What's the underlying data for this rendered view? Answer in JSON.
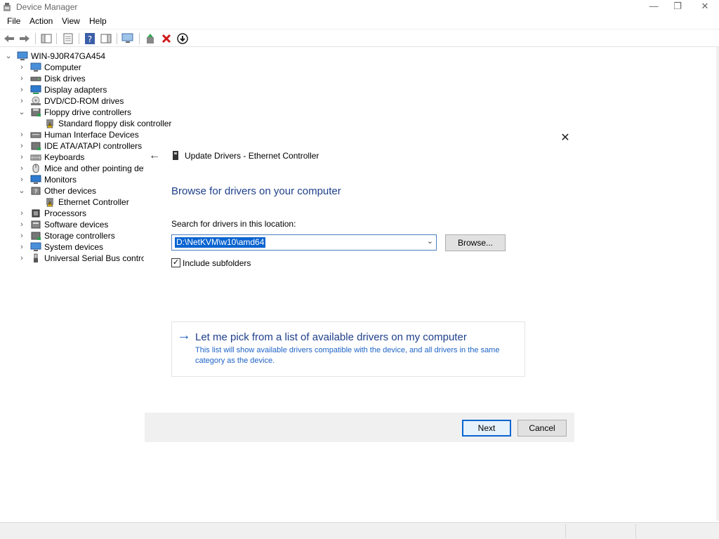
{
  "window": {
    "title": "Device Manager",
    "controls": {
      "minimize": "—",
      "restore": "❐",
      "close": "✕"
    }
  },
  "menu": [
    "File",
    "Action",
    "View",
    "Help"
  ],
  "toolbar_icons": [
    "back-arrow-icon",
    "forward-arrow-icon",
    "show-hide-console-tree-icon",
    "properties-icon",
    "help-icon",
    "action-pane-icon",
    "scan-hardware-icon",
    "update-driver-icon",
    "uninstall-icon",
    "disable-device-icon"
  ],
  "tree": {
    "root": "WIN-9J0R47GA454",
    "items": [
      {
        "label": "Computer",
        "expanded": false
      },
      {
        "label": "Disk drives",
        "expanded": false
      },
      {
        "label": "Display adapters",
        "expanded": false
      },
      {
        "label": "DVD/CD-ROM drives",
        "expanded": false
      },
      {
        "label": "Floppy drive controllers",
        "expanded": true
      },
      {
        "label": "Standard floppy disk controller",
        "child": true,
        "warning": true
      },
      {
        "label": "Human Interface Devices",
        "expanded": false
      },
      {
        "label": "IDE ATA/ATAPI controllers",
        "expanded": false
      },
      {
        "label": "Keyboards",
        "expanded": false
      },
      {
        "label": "Mice and other pointing devic",
        "expanded": false
      },
      {
        "label": "Monitors",
        "expanded": false
      },
      {
        "label": "Other devices",
        "expanded": true
      },
      {
        "label": "Ethernet Controller",
        "child": true,
        "warning": true
      },
      {
        "label": "Processors",
        "expanded": false
      },
      {
        "label": "Software devices",
        "expanded": false
      },
      {
        "label": "Storage controllers",
        "expanded": false
      },
      {
        "label": "System devices",
        "expanded": false
      },
      {
        "label": "Universal Serial Bus controller",
        "expanded": false
      }
    ]
  },
  "dialog": {
    "title": "Update Drivers - Ethernet Controller",
    "heading": "Browse for drivers on your computer",
    "search_label": "Search for drivers in this location:",
    "path_value": "D:\\NetKVM\\w10\\amd64",
    "browse_label": "Browse...",
    "include_subfolders_label": "Include subfolders",
    "include_subfolders_checked": true,
    "pick_title": "Let me pick from a list of available drivers on my computer",
    "pick_desc": "This list will show available drivers compatible with the device, and all drivers in the same category as the device.",
    "next_label": "Next",
    "cancel_label": "Cancel"
  },
  "colors": {
    "accent": "#0a64d0",
    "heading_blue": "#1e3f8a",
    "link_blue": "#1e63c6",
    "footer_bg": "#f0f0f0"
  }
}
